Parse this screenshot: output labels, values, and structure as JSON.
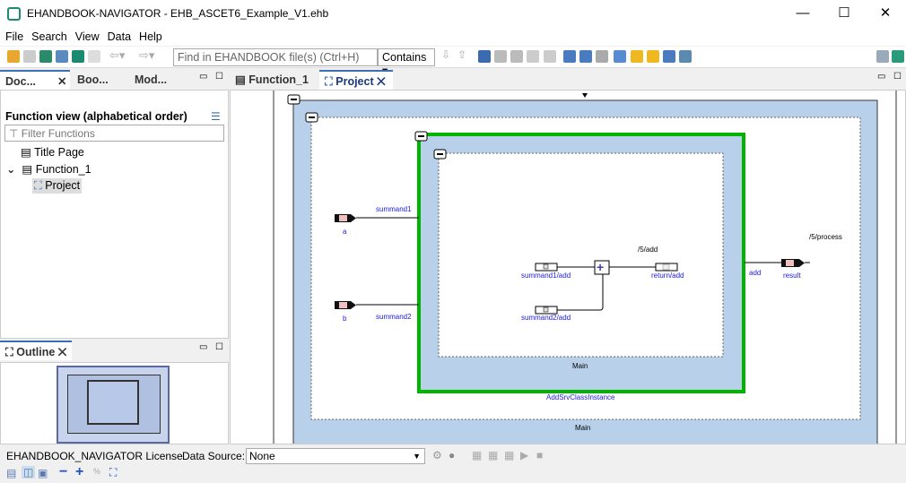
{
  "window": {
    "title": "EHANDBOOK-NAVIGATOR - EHB_ASCET6_Example_V1.ehb",
    "app_icon": "ehandbook-icon"
  },
  "menu": [
    "File",
    "Search",
    "View",
    "Data",
    "Help"
  ],
  "toolbar": {
    "search_placeholder": "Find in EHANDBOOK file(s) (Ctrl+H)",
    "match_mode": "Contains"
  },
  "left_tabs": [
    "Doc...",
    "Boo...",
    "Mod..."
  ],
  "function_view": {
    "heading": "Function view (alphabetical order)",
    "filter_placeholder": "Filter Functions",
    "items": [
      {
        "label": "Title Page"
      },
      {
        "label": "Function_1",
        "expanded": true
      },
      {
        "label": "Project",
        "selected": true
      }
    ]
  },
  "outline": {
    "title": "Outline"
  },
  "editor_tabs": [
    {
      "label": "Function_1"
    },
    {
      "label": "Project",
      "active": true
    }
  ],
  "diagram": {
    "outer_label": "Main",
    "instance_label": "AddSrvClassInstance",
    "inner_label": "Main",
    "inputs": [
      {
        "name": "a",
        "signal": "summand1"
      },
      {
        "name": "b",
        "signal": "summand2"
      }
    ],
    "inner_inputs": [
      "summand1/add",
      "summand2/add"
    ],
    "inner_output": "return/add",
    "inner_path": "/5/add",
    "output_signal": "add",
    "output_name": "result",
    "output_path": "/5/process",
    "colors": {
      "blue": "#b8d0ea",
      "green": "#00b400",
      "signal": "#2020e0"
    }
  },
  "status": {
    "license": "EHANDBOOK_NAVIGATOR License",
    "data_source_label": "Data Source:",
    "data_source": "None"
  }
}
